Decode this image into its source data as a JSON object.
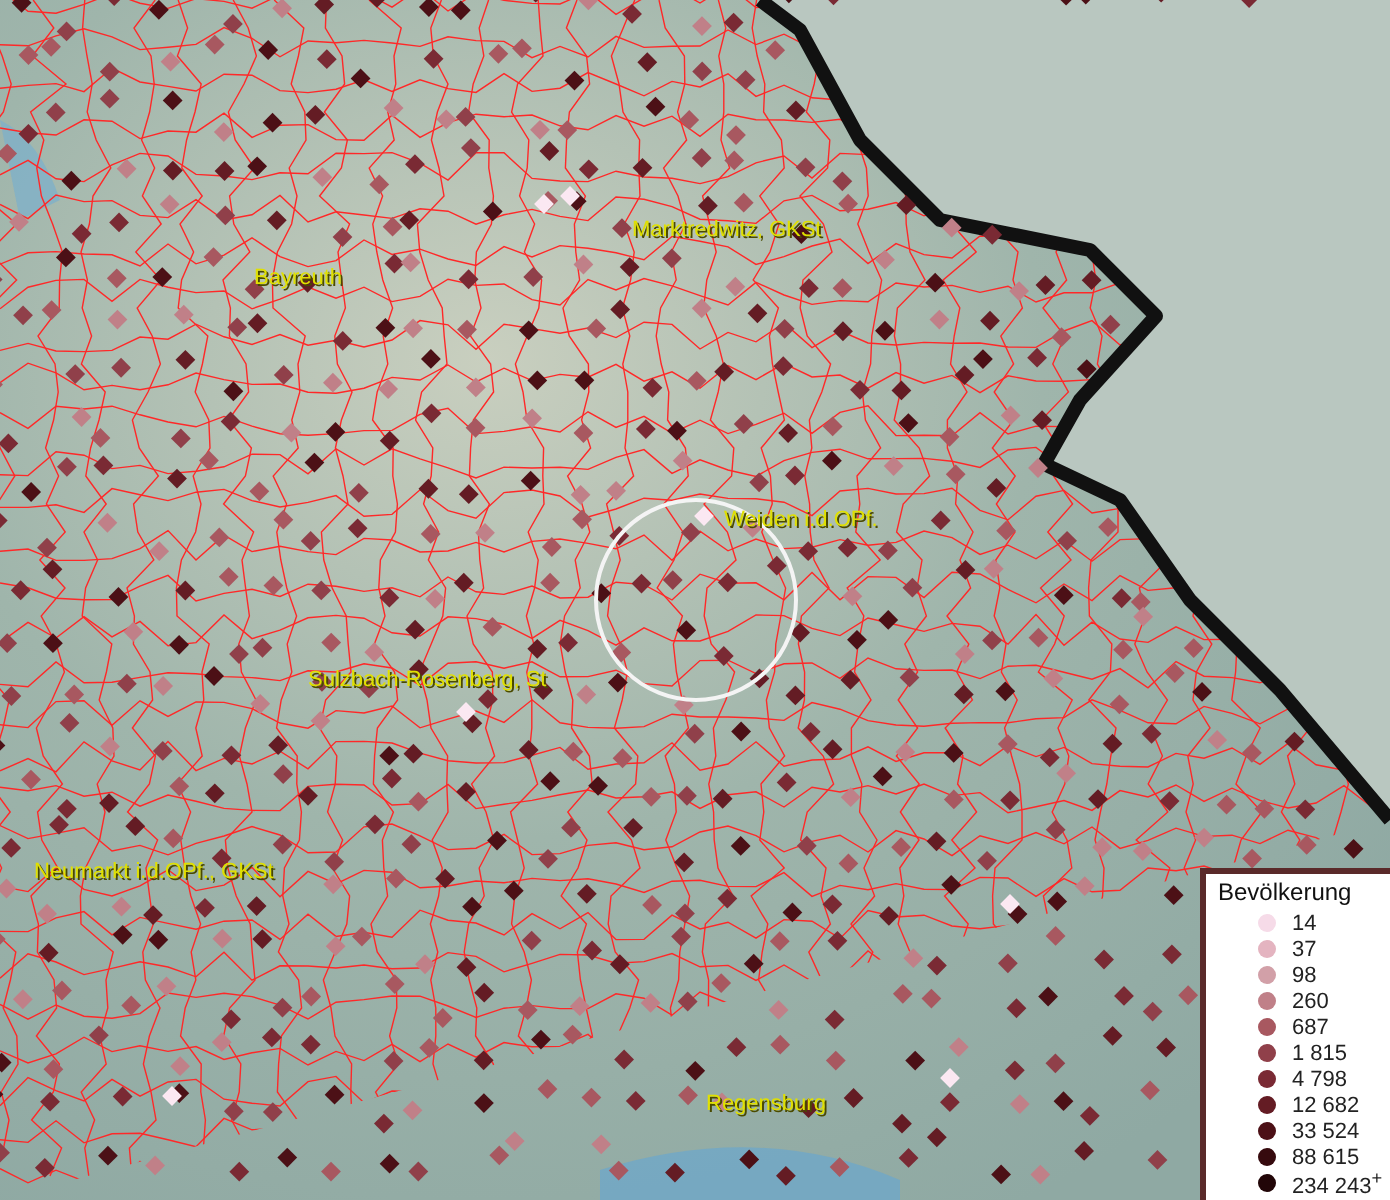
{
  "map": {
    "cities": [
      {
        "name": "Bayreuth"
      },
      {
        "name": "Marktredwitz, GKSt"
      },
      {
        "name": "Weiden i.d.OPf."
      },
      {
        "name": "Sulzbach-Rosenberg, St"
      },
      {
        "name": "Neumarkt i.d.OPf., GKSt"
      },
      {
        "name": "Regensburg"
      }
    ]
  },
  "legend": {
    "title": "Bevölkerung",
    "items": [
      {
        "label": "14",
        "color": "#f6dbe8"
      },
      {
        "label": "37",
        "color": "#e4b4c0"
      },
      {
        "label": "98",
        "color": "#d2a0a8"
      },
      {
        "label": "260",
        "color": "#c08088"
      },
      {
        "label": "687",
        "color": "#a85860"
      },
      {
        "label": "1 815",
        "color": "#90404a"
      },
      {
        "label": "4 798",
        "color": "#7a2a34"
      },
      {
        "label": "12 682",
        "color": "#641c24"
      },
      {
        "label": "33 524",
        "color": "#4c1016"
      },
      {
        "label": "88 615",
        "color": "#360a0e"
      },
      {
        "label": "234 243$^{+}$",
        "color": "#220608"
      }
    ]
  }
}
